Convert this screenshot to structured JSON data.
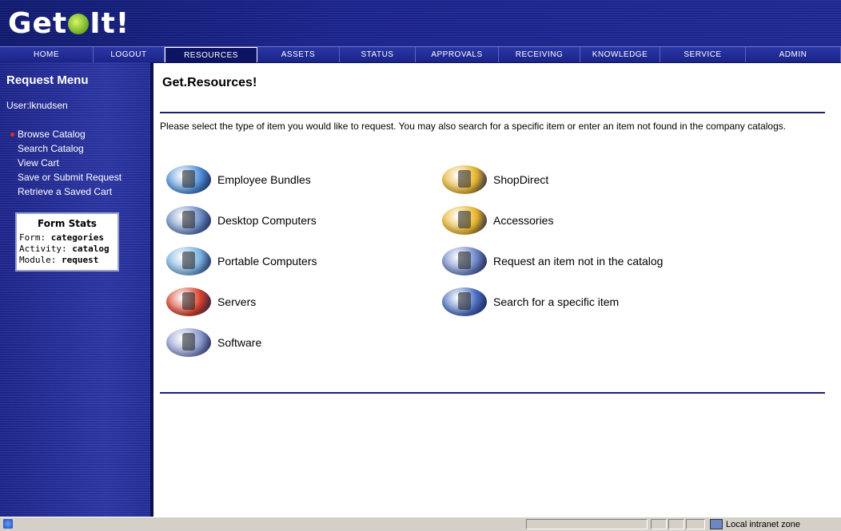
{
  "app": {
    "logo_text_left": "Get",
    "logo_text_right": "It!"
  },
  "nav": {
    "items": [
      {
        "label": "HOME",
        "width": 117
      },
      {
        "label": "LOGOUT",
        "width": 89
      },
      {
        "label": "RESOURCES",
        "width": 116,
        "active": true
      },
      {
        "label": "ASSETS",
        "width": 103
      },
      {
        "label": "STATUS",
        "width": 95
      },
      {
        "label": "APPROVALS",
        "width": 104
      },
      {
        "label": "RECEIVING",
        "width": 102
      },
      {
        "label": "KNOWLEDGE",
        "width": 100
      },
      {
        "label": "SERVICE",
        "width": 107
      },
      {
        "label": "ADMIN",
        "width": 119
      }
    ]
  },
  "sidebar": {
    "title": "Request Menu",
    "user": "User:lknudsen",
    "menu": [
      "Browse Catalog",
      "Search Catalog",
      "View Cart",
      "Save or Submit Request",
      "Retrieve a Saved Cart"
    ],
    "stats": {
      "title": "Form Stats",
      "form_label": "Form:",
      "form_value": "categories",
      "activity_label": "Activity:",
      "activity_value": "catalog",
      "module_label": "Module:",
      "module_value": "request"
    }
  },
  "main": {
    "title": "Get.Resources!",
    "intro": "Please select the type of item you would like to request. You may also search for a specific item or enter an item not found in the company catalogs.",
    "categories": [
      {
        "label": "Employee Bundles",
        "icon": "employee-bundles-icon",
        "color": "#4f8fd8"
      },
      {
        "label": "Desktop Computers",
        "icon": "desktop-computer-icon",
        "color": "#6c8cc4"
      },
      {
        "label": "Portable Computers",
        "icon": "laptop-icon",
        "color": "#78b0de"
      },
      {
        "label": "Servers",
        "icon": "server-icon",
        "color": "#d8402a"
      },
      {
        "label": "Software",
        "icon": "software-box-icon",
        "color": "#8e9cd0"
      },
      {
        "label": "ShopDirect",
        "icon": "shopdirect-icon",
        "color": "#e6b22c"
      },
      {
        "label": "Accessories",
        "icon": "accessories-icon",
        "color": "#e8b42a"
      },
      {
        "label": "Request an item not in the catalog",
        "icon": "request-item-icon",
        "color": "#6e86c8"
      },
      {
        "label": "Search for a specific item",
        "icon": "binoculars-icon",
        "color": "#4a6ec0"
      }
    ]
  },
  "statusbar": {
    "zone": "Local intranet zone"
  }
}
